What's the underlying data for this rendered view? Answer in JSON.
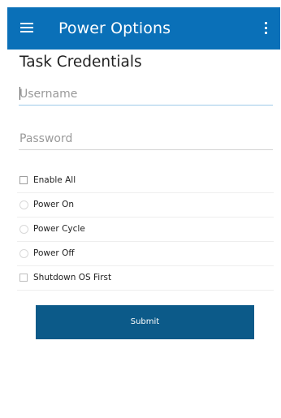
{
  "appbar": {
    "title": "Power Options",
    "menu_icon": "hamburger-menu-icon",
    "overflow_icon": "more-vertical-icon",
    "color": "#0a70b8"
  },
  "form": {
    "section_title": "Task Credentials",
    "username": {
      "placeholder": "Username",
      "value": ""
    },
    "password": {
      "placeholder": "Password",
      "value": ""
    },
    "options": {
      "enable_all": {
        "label": "Enable All",
        "type": "checkbox",
        "checked": false
      },
      "power_on": {
        "label": "Power On",
        "type": "radio",
        "selected": false
      },
      "power_cycle": {
        "label": "Power Cycle",
        "type": "radio",
        "selected": false
      },
      "power_off": {
        "label": "Power Off",
        "type": "radio",
        "selected": false
      },
      "shutdown_os_first": {
        "label": "Shutdown OS First",
        "type": "checkbox",
        "checked": false
      }
    },
    "submit_label": "Submit",
    "submit_color": "#0c5a89"
  }
}
